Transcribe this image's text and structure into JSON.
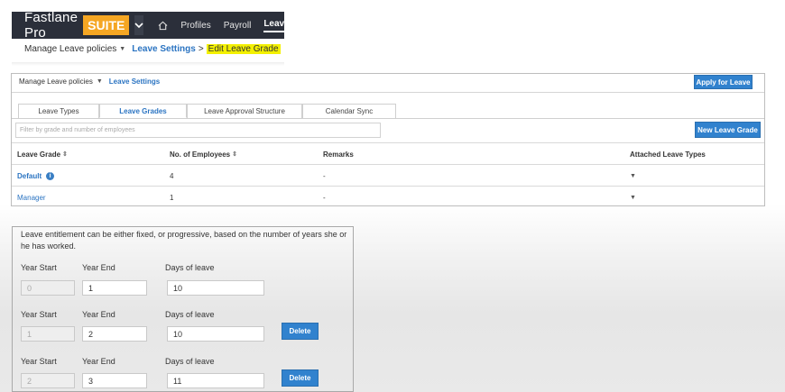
{
  "topnav": {
    "brand": "Fastlane Pro",
    "suite": "SUITE",
    "items": [
      {
        "label": "Profiles"
      },
      {
        "label": "Payroll"
      },
      {
        "label": "Leave"
      }
    ]
  },
  "breadcrumb": {
    "root": "Manage Leave policies",
    "parent": "Leave Settings",
    "separator": ">",
    "current": "Edit Leave Grade"
  },
  "panel": {
    "breadcrumb_root": "Manage Leave policies",
    "breadcrumb_link": "Leave Settings",
    "apply_button": "Apply for Leave",
    "tabs": [
      {
        "label": "Leave Types"
      },
      {
        "label": "Leave Grades"
      },
      {
        "label": "Leave Approval Structure"
      },
      {
        "label": "Calendar Sync"
      }
    ],
    "filter_placeholder": "Filter by grade and number of employees",
    "new_button": "New Leave Grade",
    "columns": [
      {
        "label": "Leave Grade",
        "sort": "⇕"
      },
      {
        "label": "No. of Employees",
        "sort": "⇕"
      },
      {
        "label": "Remarks"
      },
      {
        "label": "Attached Leave Types"
      }
    ],
    "rows": [
      {
        "grade": "Default",
        "employees": "4",
        "remarks": "-",
        "attached": "▼"
      },
      {
        "grade": "Manager",
        "employees": "1",
        "remarks": "-",
        "attached": "▼"
      }
    ]
  },
  "entitlement": {
    "description": "Leave entitlement can be either fixed, or progressive, based on the number of years she or he has worked.",
    "labels": {
      "year_start": "Year Start",
      "year_end": "Year End",
      "days": "Days of leave"
    },
    "delete_label": "Delete",
    "rows": [
      {
        "year_start": "0",
        "year_end": "1",
        "days": "10"
      },
      {
        "year_start": "1",
        "year_end": "2",
        "days": "10"
      },
      {
        "year_start": "2",
        "year_end": "3",
        "days": "11"
      }
    ]
  },
  "colors": {
    "nav_bg": "#2b2f3a",
    "suite": "#f5a623",
    "link": "#2b74c2",
    "button": "#3182ce",
    "highlight": "#f3f000"
  }
}
